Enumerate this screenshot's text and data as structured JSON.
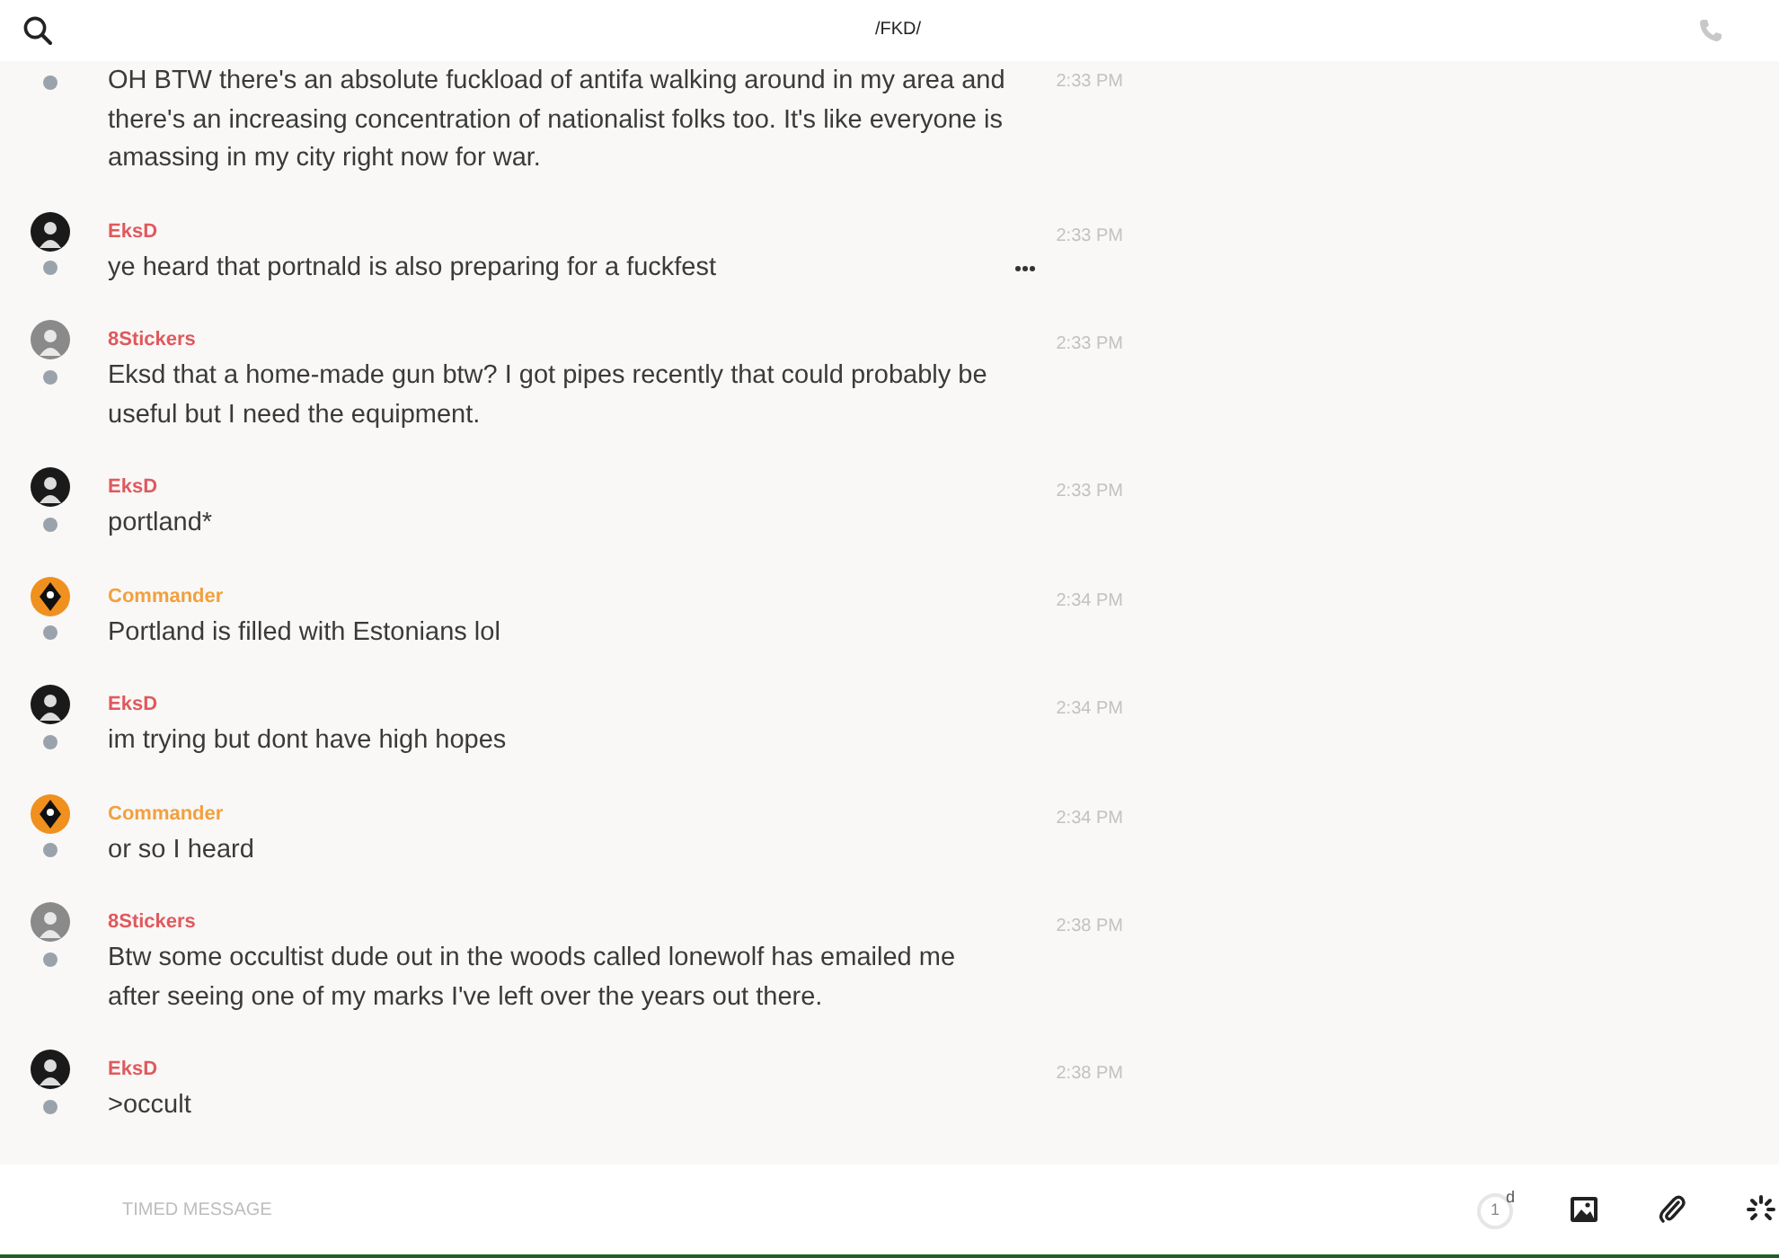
{
  "header": {
    "title": "/FKD/"
  },
  "messages": [
    {
      "text": "OH BTW there's an absolute fuckload of antifa walking around in my area and there's an increasing concentration of nationalist folks too. It's like everyone is amassing in my city right now for war.",
      "time": "2:33 PM",
      "hovered": false
    },
    {
      "author": "EksD",
      "color": "#e0595c",
      "kind": "dark",
      "text": "ye heard that portnald is also preparing for a fuckfest",
      "time": "2:33 PM",
      "hovered": true
    },
    {
      "author": "8Stickers",
      "color": "#e0595c",
      "kind": "gray",
      "text": "Eksd that a home-made gun btw? I got pipes recently that could probably be useful but I need the equipment.",
      "time": "2:33 PM",
      "hovered": false
    },
    {
      "author": "EksD",
      "color": "#e0595c",
      "kind": "dark",
      "text": "portland*",
      "time": "2:33 PM",
      "hovered": false
    },
    {
      "author": "Commander",
      "color": "#f2a03f",
      "kind": "diamond",
      "text": "Portland is filled with Estonians lol",
      "time": "2:34 PM",
      "hovered": false
    },
    {
      "author": "EksD",
      "color": "#e0595c",
      "kind": "dark",
      "text": "im trying but dont have high hopes",
      "time": "2:34 PM",
      "hovered": false
    },
    {
      "author": "Commander",
      "color": "#f2a03f",
      "kind": "diamond",
      "text": "or so I heard",
      "time": "2:34 PM",
      "hovered": false
    },
    {
      "author": "8Stickers",
      "color": "#e0595c",
      "kind": "gray",
      "text": "Btw some occultist dude out in the woods called lonewolf has emailed me after seeing one of my marks I've left over the years out there.",
      "time": "2:38 PM",
      "hovered": false
    },
    {
      "author": "EksD",
      "color": "#e0595c",
      "kind": "dark",
      "text": ">occult",
      "time": "2:38 PM",
      "hovered": false
    }
  ],
  "composer": {
    "placeholder": "TIMED MESSAGE",
    "timer": "1",
    "timer_unit": "d"
  }
}
